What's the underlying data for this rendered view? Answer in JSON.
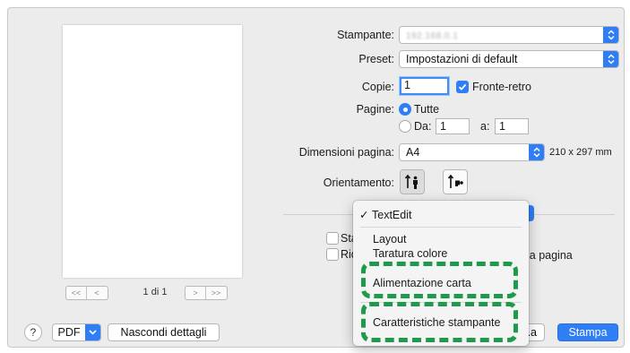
{
  "preview": {
    "page_indicator": "1 di 1",
    "nav_first": "<<",
    "nav_prev": "<",
    "nav_next": ">",
    "nav_last": ">>"
  },
  "printer": {
    "label": "Stampante:",
    "value": "192.168.0.1"
  },
  "preset": {
    "label": "Preset:",
    "value": "Impostazioni di default"
  },
  "copies": {
    "label": "Copie:",
    "value": "1",
    "duplex_label": "Fronte-retro",
    "duplex_checked": true
  },
  "pages": {
    "label": "Pagine:",
    "all_label": "Tutte",
    "from_label": "Da:",
    "from_value": "1",
    "to_label": "a:",
    "to_value": "1"
  },
  "paper_size": {
    "label": "Dimensioni pagina:",
    "value": "A4",
    "dimensions": "210 x 297 mm"
  },
  "orientation": {
    "label": "Orientamento:"
  },
  "background_options": {
    "row1_partial": "Sta",
    "row2_partial": "Rid",
    "row2_tail": "la pagina",
    "button_partial": "..a"
  },
  "menu": {
    "items": [
      {
        "label": "TextEdit",
        "checked": true
      },
      {
        "label": "Layout"
      },
      {
        "label": "Taratura colore"
      },
      {
        "label": "Alimentazione carta"
      },
      {
        "label": "Caratteristiche stampante"
      }
    ],
    "check_mark": "✓"
  },
  "bottom": {
    "help_label": "?",
    "pdf_label": "PDF",
    "hide_details_label": "Nascondi dettagli",
    "print_label": "Stampa"
  },
  "colors": {
    "accent": "#2f7ef5",
    "highlight": "#1e9a4a"
  }
}
